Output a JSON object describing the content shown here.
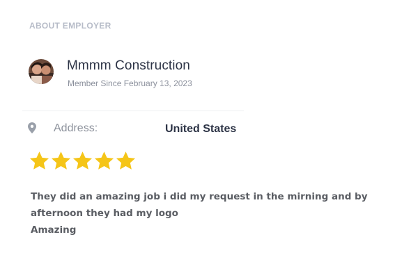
{
  "section": {
    "title": "ABOUT EMPLOYER"
  },
  "employer": {
    "name": "Mmmm Construction",
    "member_since": "Member Since February 13, 2023",
    "avatar_icon": "avatar"
  },
  "address": {
    "icon": "location-pin-icon",
    "label": "Address:",
    "value": "United States"
  },
  "rating": {
    "stars": 5,
    "max": 5,
    "color": "#f5c518"
  },
  "review": {
    "lines": [
      "They did an amazing job i did my request in the mirning and by",
      "afternoon they had my logo",
      "Amazing"
    ]
  }
}
